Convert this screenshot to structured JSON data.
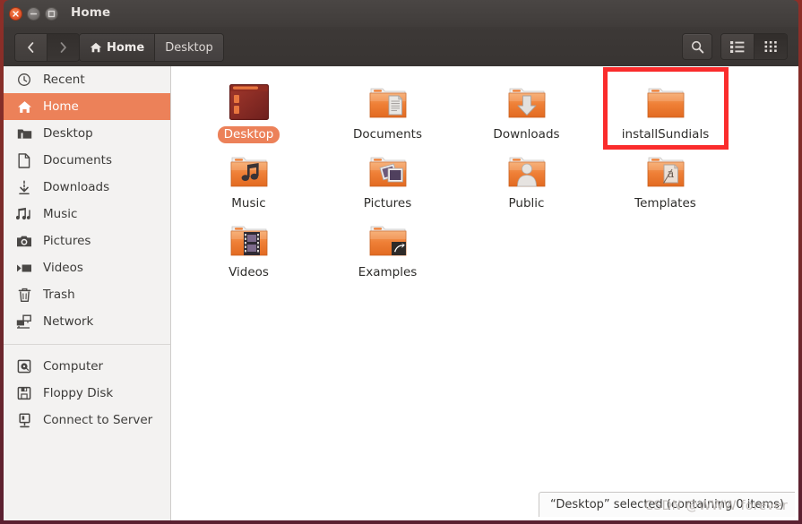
{
  "window": {
    "title": "Home",
    "controls": {
      "close": "close-button",
      "minimize": "minimize-button",
      "maximize": "maximize-button"
    }
  },
  "toolbar": {
    "back_label": "‹",
    "forward_label": "›",
    "breadcrumbs": [
      {
        "label": "Home",
        "active": true,
        "icon": "home-icon"
      },
      {
        "label": "Desktop",
        "active": false,
        "icon": ""
      }
    ],
    "search_icon": "search-icon",
    "list_view_icon": "list-view-icon",
    "grid_view_icon": "grid-view-icon",
    "active_view": "grid"
  },
  "sidebar": {
    "groups": [
      {
        "items": [
          {
            "label": "Recent",
            "icon": "clock-icon",
            "selected": false
          },
          {
            "label": "Home",
            "icon": "home-icon",
            "selected": true
          },
          {
            "label": "Desktop",
            "icon": "folder-icon",
            "selected": false
          },
          {
            "label": "Documents",
            "icon": "document-icon",
            "selected": false
          },
          {
            "label": "Downloads",
            "icon": "download-icon",
            "selected": false
          },
          {
            "label": "Music",
            "icon": "music-note-icon",
            "selected": false
          },
          {
            "label": "Pictures",
            "icon": "camera-icon",
            "selected": false
          },
          {
            "label": "Videos",
            "icon": "video-icon",
            "selected": false
          },
          {
            "label": "Trash",
            "icon": "trash-icon",
            "selected": false
          },
          {
            "label": "Network",
            "icon": "network-icon",
            "selected": false
          }
        ]
      },
      {
        "items": [
          {
            "label": "Computer",
            "icon": "computer-disk-icon",
            "selected": false
          },
          {
            "label": "Floppy Disk",
            "icon": "floppy-disk-icon",
            "selected": false
          },
          {
            "label": "Connect to Server",
            "icon": "server-icon",
            "selected": false
          }
        ]
      }
    ]
  },
  "files": [
    {
      "name": "Desktop",
      "icon": "desktop-window-icon",
      "selected": true,
      "highlighted": false
    },
    {
      "name": "Documents",
      "icon": "folder-documents-icon",
      "selected": false,
      "highlighted": false
    },
    {
      "name": "Downloads",
      "icon": "folder-downloads-icon",
      "selected": false,
      "highlighted": false
    },
    {
      "name": "installSundials",
      "icon": "folder-plain-icon",
      "selected": false,
      "highlighted": true
    },
    {
      "name": "Music",
      "icon": "folder-music-icon",
      "selected": false,
      "highlighted": false
    },
    {
      "name": "Pictures",
      "icon": "folder-pictures-icon",
      "selected": false,
      "highlighted": false
    },
    {
      "name": "Public",
      "icon": "folder-public-icon",
      "selected": false,
      "highlighted": false
    },
    {
      "name": "Templates",
      "icon": "folder-templates-icon",
      "selected": false,
      "highlighted": false
    },
    {
      "name": "Videos",
      "icon": "folder-videos-icon",
      "selected": false,
      "highlighted": false
    },
    {
      "name": "Examples",
      "icon": "folder-link-icon",
      "selected": false,
      "highlighted": false
    }
  ],
  "status": {
    "text": "“Desktop” selected (containing 0 items)"
  },
  "watermark": {
    "text": "CSDN @WWW forever"
  },
  "colors": {
    "selection_orange": "#ec8159",
    "annotation_red": "#fa2c2c",
    "titlebar": "#413d3b",
    "sidebar_bg": "#f3f2f1"
  }
}
